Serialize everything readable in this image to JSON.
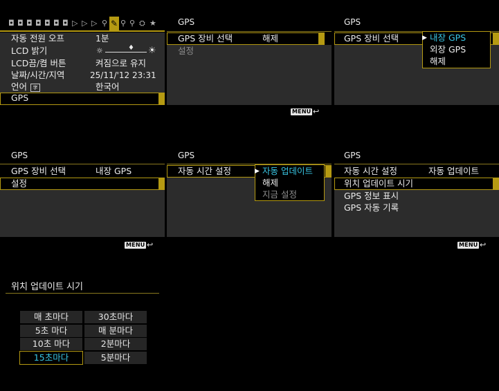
{
  "p1": {
    "tabs": [
      "camera-tab-1-icon",
      "camera-tab-2-icon",
      "camera-tab-3-icon",
      "camera-tab-4-icon",
      "camera-tab-5-icon",
      "playback-tab-1-icon",
      "playback-tab-2-icon",
      "playback-tab-3-icon",
      "setup-tab-1-icon",
      "setup-tab-2-icon",
      "setup-tab-3-icon",
      "setup-tab-4-icon",
      "custom-function-tab-icon",
      "my-menu-star-icon"
    ],
    "items": [
      {
        "label": "자동 전원 오프",
        "value": "1분"
      },
      {
        "label": "LCD 밝기",
        "value": ""
      },
      {
        "label": "LCD끔/켬 버튼",
        "value": "켜짐으로 유지"
      },
      {
        "label": "날짜/시간/지역",
        "value": "25/11/'12 23:31"
      },
      {
        "label": "언어",
        "value": "한국어"
      },
      {
        "label": "GPS",
        "value": ""
      }
    ]
  },
  "p2": {
    "title": "GPS",
    "items": [
      {
        "label": "GPS 장비 선택",
        "value": "해제"
      },
      {
        "label": "설정",
        "value": ""
      }
    ],
    "menu": "MENU",
    "back": "↩"
  },
  "p3": {
    "title": "GPS",
    "items": [
      {
        "label": "GPS 장비 선택"
      }
    ],
    "options": [
      "내장 GPS",
      "외장 GPS",
      "해제"
    ]
  },
  "p4": {
    "title": "GPS",
    "items": [
      {
        "label": "GPS 장비 선택",
        "value": "내장 GPS"
      },
      {
        "label": "설정"
      }
    ],
    "menu": "MENU",
    "back": "↩"
  },
  "p5": {
    "title": "GPS",
    "items": [
      {
        "label": "자동 시간 설정"
      }
    ],
    "options": [
      "자동 업데이트",
      "해제",
      "지금 설정"
    ]
  },
  "p6": {
    "title": "GPS",
    "items": [
      {
        "label": "자동 시간 설정",
        "value": "자동 업데이트"
      },
      {
        "label": "위치 업데이트 시기"
      },
      {
        "label": "GPS 정보 표시"
      },
      {
        "label": "GPS 자동 기록"
      }
    ],
    "menu": "MENU",
    "back": "↩"
  },
  "p7": {
    "title": "위치 업데이트 시기",
    "grid": [
      [
        "매 초마다",
        "30초마다"
      ],
      [
        "5초 마다",
        "매 분마다"
      ],
      [
        "10초 마다",
        "2분마다"
      ],
      [
        "15초마다",
        "5분마다"
      ]
    ]
  },
  "colors": {
    "accent": "#b59a12",
    "highlight": "#39c6e4",
    "row": "#2c2c2c"
  }
}
